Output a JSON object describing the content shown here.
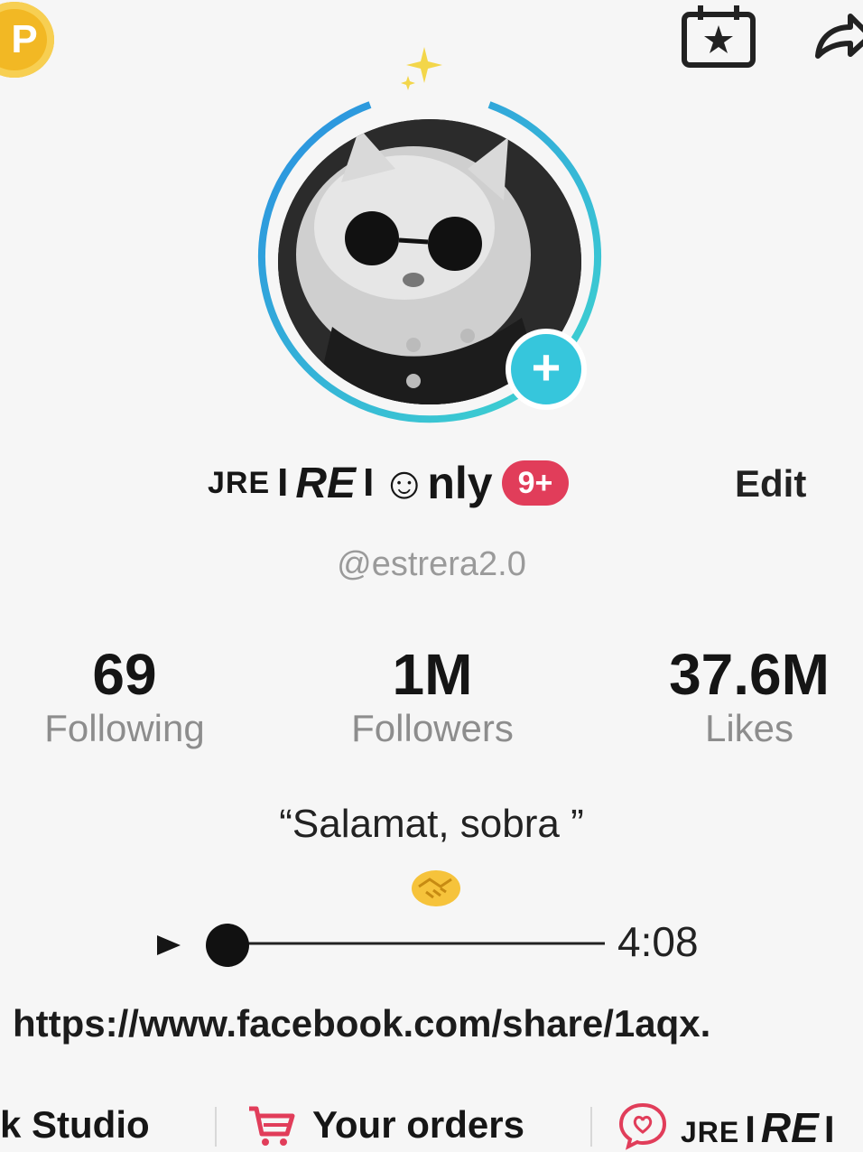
{
  "topbar": {
    "coin_label": "P",
    "calendar_icon": "calendar-star-icon",
    "share_icon": "share-arrow-icon"
  },
  "profile": {
    "name_prefix": "JRE",
    "name_separator": "I",
    "name_main": "RE",
    "name_suffix": "☺nly",
    "notification_badge": "9+",
    "edit_label": "Edit",
    "handle": "@estrera2.0",
    "add_icon": "plus-icon",
    "accent_color": "#36c6dc",
    "badge_color": "#e13d5a"
  },
  "stats": [
    {
      "value": "69",
      "label": "Following"
    },
    {
      "value": "1M",
      "label": "Followers"
    },
    {
      "value": "37.6M",
      "label": "Likes"
    }
  ],
  "bio": {
    "text": "“Salamat, sobra ”",
    "emoji": "handshake-emoji"
  },
  "audio": {
    "play_icon": "play-icon",
    "progress": 0,
    "duration": "4:08"
  },
  "link": {
    "text": "https://www.facebook.com/share/1aqx."
  },
  "bottom_row": {
    "studio_label": "k Studio",
    "orders_label": "Your orders",
    "orders_icon": "cart-icon",
    "group_icon": "chat-heart-icon",
    "group_prefix": "JRE",
    "group_separator": "I",
    "group_main": "RE",
    "group_tail": "I"
  }
}
